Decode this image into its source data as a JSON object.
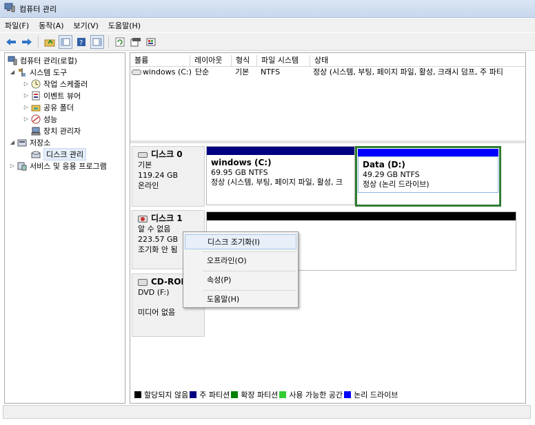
{
  "window": {
    "title": "컴퓨터 관리",
    "icon": "computer-management-icon"
  },
  "menubar": [
    "파일(F)",
    "동작(A)",
    "보기(V)",
    "도움말(H)"
  ],
  "toolbar_icons": [
    "back-arrow-icon",
    "forward-arrow-icon",
    "up-folder-icon",
    "show-hide-tree-icon",
    "help-icon",
    "show-action-pane-icon",
    "refresh-icon",
    "properties-icon",
    "export-icon"
  ],
  "tree": {
    "root": "컴퓨터 관리(로컬)",
    "system_tools": "시스템 도구",
    "task_scheduler": "작업 스케줄러",
    "event_viewer": "이벤트 뷰어",
    "shared_folders": "공유 폴더",
    "performance": "성능",
    "device_manager": "장치 관리자",
    "storage": "저장소",
    "disk_management": "디스크 관리",
    "services": "서비스 및 응용 프로그램"
  },
  "volume_table": {
    "columns": [
      "볼륨",
      "레이아웃",
      "형식",
      "파일 시스템",
      "상태"
    ],
    "rows": [
      {
        "volume": "windows (C:)",
        "layout": "단순",
        "type": "기본",
        "fs": "NTFS",
        "status": "정상 (시스템, 부팅, 페이지 파일, 활성, 크래시 덤프, 주 파티"
      }
    ]
  },
  "disks": [
    {
      "name": "디스크 0",
      "kind": "기본",
      "size": "119.24 GB",
      "state": "온라인",
      "partitions": [
        {
          "name": "windows  (C:)",
          "size": "69.95 GB NTFS",
          "status": "정상 (시스템, 부팅, 페이지 파일, 활성, 크",
          "color": "#000080"
        },
        {
          "name": "Data  (D:)",
          "size": "49.29 GB NTFS",
          "status": "정상 (논리 드라이브)",
          "color": "#0000ff",
          "selected_border": "#2e7d32"
        }
      ]
    },
    {
      "name": "디스크 1",
      "kind": "알 수 없음",
      "size": "223.57 GB",
      "state": "조기화 안 됨",
      "partitions": [
        {
          "color": "#000000"
        }
      ]
    },
    {
      "name": "CD-ROM",
      "kind": "DVD (F:)",
      "state": "미디어 없음"
    }
  ],
  "context_menu": {
    "items": [
      "디스크 조기화(I)",
      "오프라인(O)",
      "속성(P)",
      "도움말(H)"
    ],
    "highlighted": "디스크 조기화(I)"
  },
  "legend": [
    {
      "label": "할당되지 않음",
      "color": "#000000"
    },
    {
      "label": "주 파티션",
      "color": "#000080"
    },
    {
      "label": "확장 파티션",
      "color": "#008000"
    },
    {
      "label": "사용 가능한 공간",
      "color": "#33cc33"
    },
    {
      "label": "논리 드라이브",
      "color": "#0000ff"
    }
  ]
}
